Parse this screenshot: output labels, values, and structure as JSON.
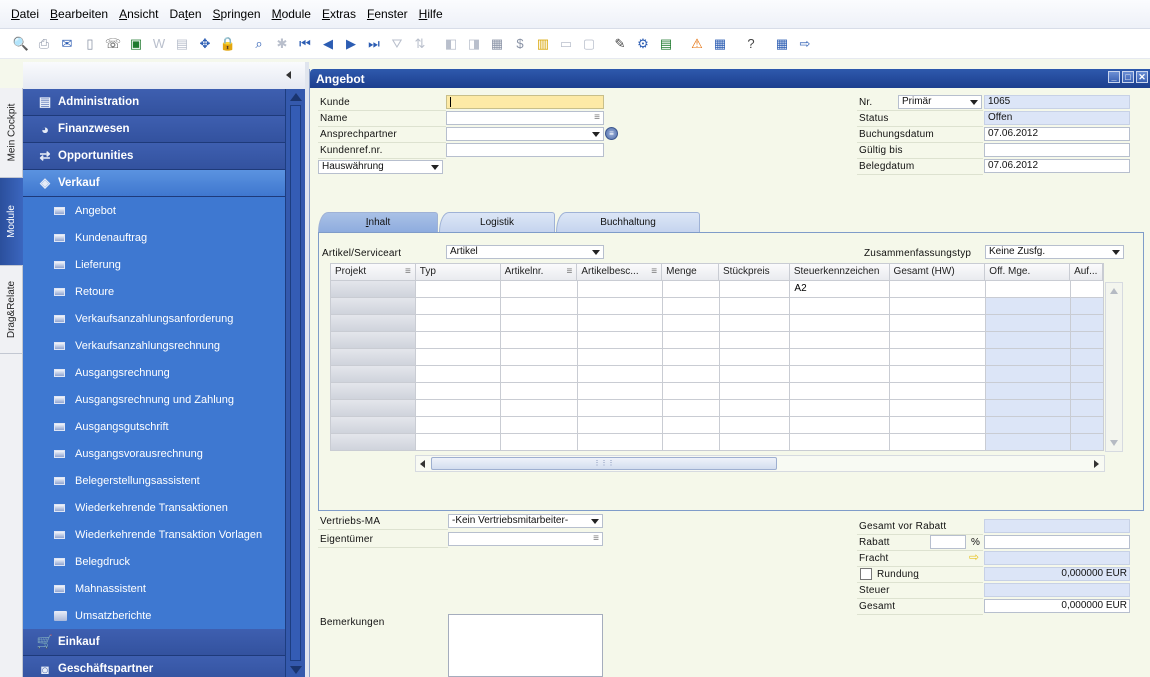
{
  "menubar": {
    "items": [
      {
        "label": "Datei",
        "mnemonic": "D",
        "rest": "atei"
      },
      {
        "label": "Bearbeiten",
        "mnemonic": "B",
        "rest": "earbeiten"
      },
      {
        "label": "Ansicht",
        "mnemonic": "A",
        "rest": "nsicht"
      },
      {
        "label": "Daten",
        "pre": "Da",
        "mnemonic": "t",
        "rest": "en"
      },
      {
        "label": "Springen",
        "mnemonic": "S",
        "rest": "pringen"
      },
      {
        "label": "Module",
        "mnemonic": "M",
        "rest": "odule"
      },
      {
        "label": "Extras",
        "mnemonic": "E",
        "rest": "xtras"
      },
      {
        "label": "Fenster",
        "mnemonic": "F",
        "rest": "enster"
      },
      {
        "label": "Hilfe",
        "mnemonic": "H",
        "rest": "ilfe"
      }
    ]
  },
  "toolbar": {
    "icons": [
      "print-preview-icon",
      "print-icon",
      "email-icon",
      "sms-icon",
      "fax-icon",
      "excel-icon",
      "word-icon",
      "pdf-icon",
      "move-icon",
      "lock-icon",
      "find-icon",
      "add-icon",
      "first-record-icon",
      "previous-record-icon",
      "next-record-icon",
      "last-record-icon",
      "filter-icon",
      "sort-icon",
      "base-document-icon",
      "target-document-icon",
      "gross-profit-icon",
      "payment-means-icon",
      "volume-weight-icon",
      "layout-icon",
      "preview-icon",
      "edit-icon",
      "settings-icon",
      "form-settings-icon",
      "alert-icon",
      "calendar-icon",
      "help-icon",
      "query-manager-icon",
      "export-icon"
    ]
  },
  "vtabs": {
    "cockpit": "Mein Cockpit",
    "module": "Module",
    "drag": "Drag&Relate"
  },
  "sidebar": {
    "modules_top": [
      {
        "label": "Administration",
        "icon": "administration-icon"
      },
      {
        "label": "Finanzwesen",
        "icon": "finance-icon"
      },
      {
        "label": "Opportunities",
        "icon": "opportunities-icon"
      }
    ],
    "active_module": {
      "label": "Verkauf",
      "icon": "sales-tag-icon"
    },
    "sub_items": [
      "Angebot",
      "Kundenauftrag",
      "Lieferung",
      "Retoure",
      "Verkaufsanzahlungsanforderung",
      "Verkaufsanzahlungsrechnung",
      "Ausgangsrechnung",
      "Ausgangsrechnung und Zahlung",
      "Ausgangsgutschrift",
      "Ausgangsvorausrechnung",
      "Belegerstellungsassistent",
      "Wiederkehrende Transaktionen",
      "Wiederkehrende Transaktion Vorlagen",
      "Belegdruck",
      "Mahnassistent"
    ],
    "folder_item": "Umsatzberichte",
    "modules_bottom": [
      {
        "label": "Einkauf",
        "icon": "cart-icon"
      },
      {
        "label": "Geschäftspartner",
        "icon": "business-partner-icon"
      }
    ]
  },
  "document": {
    "title": "Angebot",
    "window_buttons": {
      "minimize": "_",
      "maximize": "□",
      "close": "✕"
    },
    "header_left": {
      "kunde_label": "Kunde",
      "kunde_value": "",
      "name_label": "Name",
      "name_value": "",
      "ansprechpartner_label": "Ansprechpartner",
      "ansprechpartner_value": "",
      "kundenref_label": "Kundenref.nr.",
      "kundenref_value": "",
      "currency_select": "Hauswährung"
    },
    "header_right": {
      "nr_label": "Nr.",
      "nr_series": "Primär",
      "nr_value": "1065",
      "status_label": "Status",
      "status_value": "Offen",
      "buchungsdatum_label": "Buchungsdatum",
      "buchungsdatum_value": "07.06.2012",
      "gueltig_label": "Gültig bis",
      "gueltig_value": "",
      "belegdatum_label": "Belegdatum",
      "belegdatum_value": "07.06.2012"
    },
    "tabs": [
      {
        "label": "Inhalt",
        "mnemonic": "I",
        "rest": "nhalt",
        "active": true
      },
      {
        "label": "Logistik",
        "active": false
      },
      {
        "label": "Buchhaltung",
        "active": false
      }
    ],
    "content": {
      "artikelart_label": "Artikel/Serviceart",
      "artikelart_value": "Artikel",
      "zusammenfassung_label": "Zusammenfassungstyp",
      "zusammenfassung_value": "Keine Zusfg."
    },
    "grid": {
      "columns": [
        "Projekt",
        "Typ",
        "Artikelnr.",
        "Artikelbesc...",
        "Menge",
        "Stückpreis",
        "Steuerkennzeichen",
        "Gesamt (HW)",
        "Off. Mge.",
        "Auf..."
      ],
      "rows": [
        [
          "",
          "",
          "",
          "",
          "",
          "",
          "A2",
          "",
          "",
          ""
        ],
        [
          "",
          "",
          "",
          "",
          "",
          "",
          "",
          "",
          "",
          ""
        ],
        [
          "",
          "",
          "",
          "",
          "",
          "",
          "",
          "",
          "",
          ""
        ],
        [
          "",
          "",
          "",
          "",
          "",
          "",
          "",
          "",
          "",
          ""
        ],
        [
          "",
          "",
          "",
          "",
          "",
          "",
          "",
          "",
          "",
          ""
        ],
        [
          "",
          "",
          "",
          "",
          "",
          "",
          "",
          "",
          "",
          ""
        ],
        [
          "",
          "",
          "",
          "",
          "",
          "",
          "",
          "",
          "",
          ""
        ],
        [
          "",
          "",
          "",
          "",
          "",
          "",
          "",
          "",
          "",
          ""
        ],
        [
          "",
          "",
          "",
          "",
          "",
          "",
          "",
          "",
          "",
          ""
        ],
        [
          "",
          "",
          "",
          "",
          "",
          "",
          "",
          "",
          "",
          ""
        ]
      ]
    },
    "footer_left": {
      "vertriebs_label": "Vertriebs-MA",
      "vertriebs_value": "-Kein Vertriebsmitarbeiter-",
      "eigentuemer_label": "Eigentümer",
      "eigentuemer_value": "",
      "bemerkungen_label": "Bemerkungen",
      "bemerkungen_value": ""
    },
    "footer_right": {
      "gesamt_vor_rabatt_label": "Gesamt vor Rabatt",
      "gesamt_vor_rabatt_value": "",
      "rabatt_label": "Rabatt",
      "rabatt_percent": "",
      "percent_sign": "%",
      "rabatt_value": "",
      "fracht_label": "Fracht",
      "fracht_value": "",
      "rundung_label": "Rundung",
      "rundung_mnemonic_pre": "Rundun",
      "rundung_mnemonic": "g",
      "rundung_checked": false,
      "rundung_value": "0,000000 EUR",
      "steuer_label": "Steuer",
      "steuer_value": "",
      "gesamt_label": "Gesamt",
      "gesamt_value": "0,000000 EUR"
    }
  }
}
